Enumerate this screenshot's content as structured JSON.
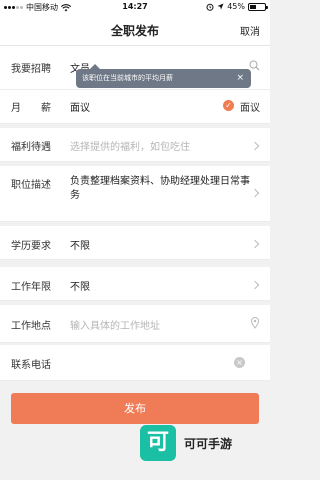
{
  "status_bar": {
    "carrier": "中国移动",
    "time": "14:27",
    "battery": "45%",
    "battery_level": 0.45
  },
  "nav": {
    "title": "全职发布",
    "cancel": "取消"
  },
  "tooltip": {
    "text": "该职位在当前城市的平均月薪",
    "close": "×"
  },
  "form": {
    "job": {
      "label": "我要招聘",
      "value": "文员"
    },
    "salary": {
      "label": "月　　薪",
      "value": "面议",
      "option": "面议",
      "option_checked": true
    },
    "benefits": {
      "label": "福利待遇",
      "placeholder": "选择提供的福利，如包吃住"
    },
    "description": {
      "label": "职位描述",
      "value": "负责整理档案资料、协助经理处理日常事务"
    },
    "education": {
      "label": "学历要求",
      "value": "不限"
    },
    "experience": {
      "label": "工作年限",
      "value": "不限"
    },
    "location": {
      "label": "工作地点",
      "placeholder": "输入具体的工作地址"
    },
    "phone": {
      "label": "联系电话",
      "value": ""
    }
  },
  "publish_button": {
    "label": "发布"
  },
  "watermark": {
    "logo_char": "可",
    "text": "可可手游"
  },
  "colors": {
    "accent": "#ef7c57",
    "tooltip_bg": "#6f7886",
    "watermark_green": "#1bbfa3"
  }
}
